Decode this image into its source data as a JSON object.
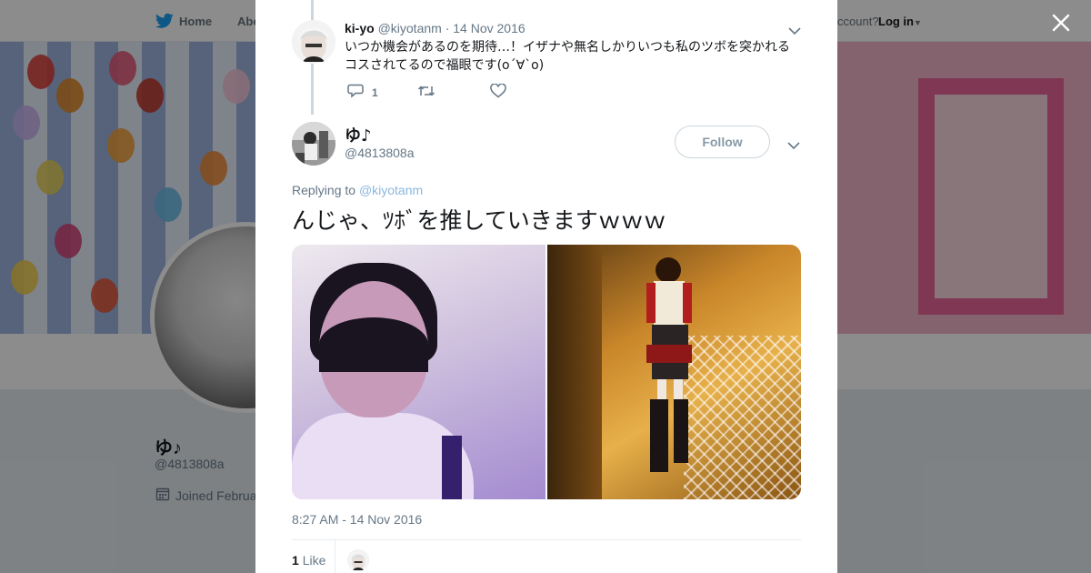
{
  "background_page": {
    "nav": {
      "home_label": "Home",
      "about_label": "Abo",
      "account_text": "ccount?",
      "login_label": "Log in"
    },
    "profile": {
      "name": "ゆ♪",
      "handle": "@4813808a",
      "joined": "Joined Februa"
    }
  },
  "modal": {
    "close_icon": "close-icon",
    "reply_tweet": {
      "name": "ki-yo",
      "handle": "@kiyotanm",
      "date": "· 14 Nov 2016",
      "text": "いつか機会があるのを期待…！イザナや無名しかりいつも私のツボを突かれるコスされてるので福眼です(o´∀`o)",
      "reply_count": "1"
    },
    "main_tweet": {
      "name": "ゆ♪",
      "handle": "@4813808a",
      "follow_label": "Follow",
      "replying_prefix": "Replying to",
      "replying_to": "@kiyotanm",
      "text": "んじゃ、ﾂﾎﾞを推していきますｗｗｗ",
      "timestamp": "8:27 AM - 14 Nov 2016",
      "like_count": "1",
      "like_label": "Like"
    }
  },
  "colors": {
    "twitter_blue": "#1da1f2",
    "link_blue": "#8ab8df",
    "muted_text": "#657786",
    "divider": "#e6ecf0"
  }
}
